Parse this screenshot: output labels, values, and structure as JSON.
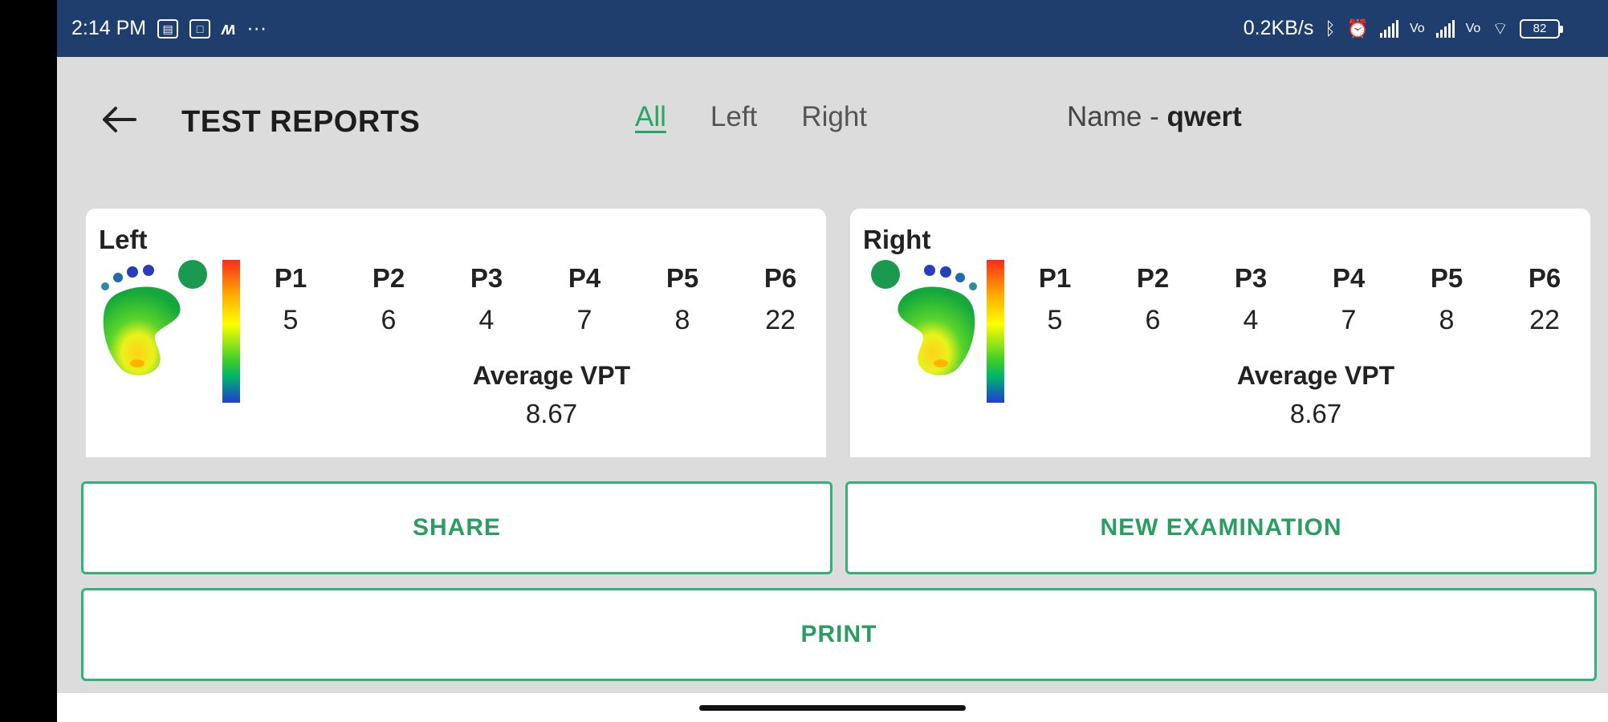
{
  "status_bar": {
    "time": "2:14 PM",
    "more": "···",
    "net_speed": "0.2KB/s",
    "battery": "82"
  },
  "header": {
    "title": "TEST REPORTS",
    "tabs": [
      {
        "label": "All",
        "active": true
      },
      {
        "label": "Left",
        "active": false
      },
      {
        "label": "Right",
        "active": false
      }
    ],
    "name_prefix": "Name - ",
    "name_value": "qwert"
  },
  "reports": [
    {
      "side": "Left",
      "points": [
        {
          "label": "P1",
          "value": "5"
        },
        {
          "label": "P2",
          "value": "6"
        },
        {
          "label": "P3",
          "value": "4"
        },
        {
          "label": "P4",
          "value": "7"
        },
        {
          "label": "P5",
          "value": "8"
        },
        {
          "label": "P6",
          "value": "22"
        }
      ],
      "average_label": "Average VPT",
      "average_value": "8.67"
    },
    {
      "side": "Right",
      "points": [
        {
          "label": "P1",
          "value": "5"
        },
        {
          "label": "P2",
          "value": "6"
        },
        {
          "label": "P3",
          "value": "4"
        },
        {
          "label": "P4",
          "value": "7"
        },
        {
          "label": "P5",
          "value": "8"
        },
        {
          "label": "P6",
          "value": "22"
        }
      ],
      "average_label": "Average VPT",
      "average_value": "8.67"
    }
  ],
  "buttons": {
    "share": "SHARE",
    "new_examination": "NEW EXAMINATION",
    "print": "PRINT"
  },
  "colors": {
    "status_bar": "#1f3d6d",
    "accent": "#27a566",
    "background": "#dcdcdc"
  }
}
